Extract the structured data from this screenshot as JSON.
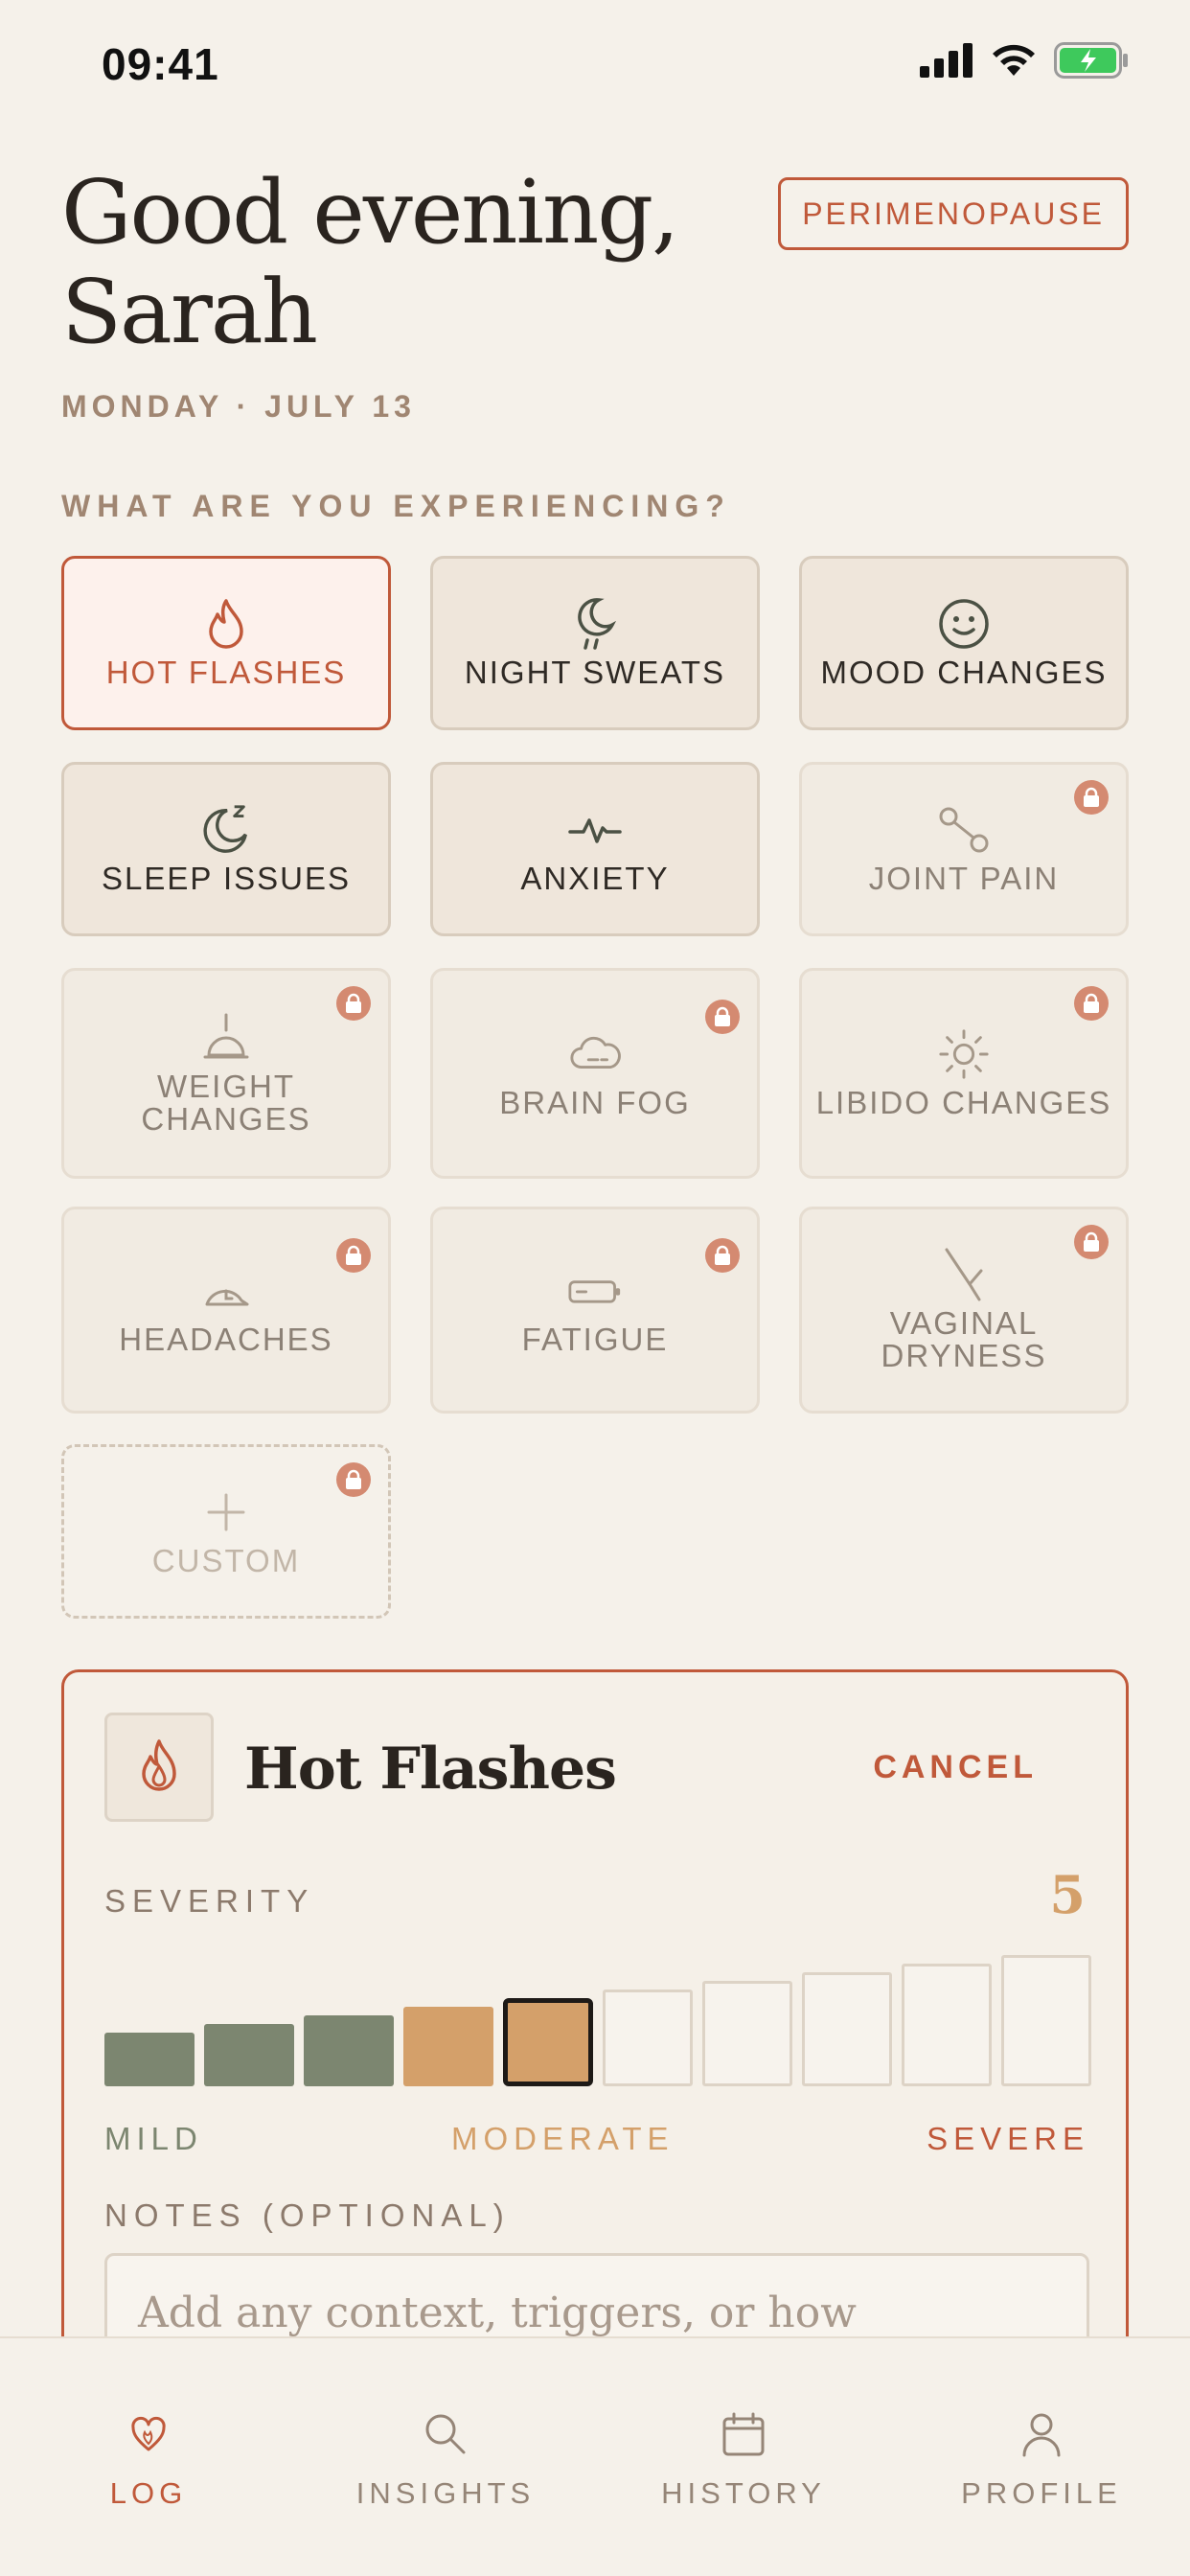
{
  "status_bar": {
    "time": "09:41"
  },
  "header": {
    "greeting": "Good evening, Sarah",
    "phase_badge": "PERIMENOPAUSE",
    "date": "MONDAY · JULY 13"
  },
  "symptoms_section": {
    "label": "WHAT ARE YOU EXPERIENCING?"
  },
  "symptoms": [
    {
      "label": "HOT FLASHES",
      "icon": "flame-icon",
      "state": "selected",
      "locked": false
    },
    {
      "label": "NIGHT SWEATS",
      "icon": "moon-drops-icon",
      "state": "available",
      "locked": false
    },
    {
      "label": "MOOD CHANGES",
      "icon": "smiley-icon",
      "state": "available",
      "locked": false
    },
    {
      "label": "SLEEP ISSUES",
      "icon": "moon-z-icon",
      "state": "available",
      "locked": false
    },
    {
      "label": "ANXIETY",
      "icon": "pulse-icon",
      "state": "available",
      "locked": false
    },
    {
      "label": "JOINT PAIN",
      "icon": "joint-icon",
      "state": "locked",
      "locked": true
    },
    {
      "label": "WEIGHT CHANGES",
      "icon": "scale-icon",
      "state": "locked",
      "locked": true
    },
    {
      "label": "BRAIN FOG",
      "icon": "cloud-icon",
      "state": "locked",
      "locked": true
    },
    {
      "label": "LIBIDO CHANGES",
      "icon": "sun-icon",
      "state": "locked",
      "locked": true
    },
    {
      "label": "HEADACHES",
      "icon": "head-icon",
      "state": "locked",
      "locked": true
    },
    {
      "label": "FATIGUE",
      "icon": "battery-icon",
      "state": "locked",
      "locked": true
    },
    {
      "label": "VAGINAL DRYNESS",
      "icon": "feather-icon",
      "state": "locked",
      "locked": true
    },
    {
      "label": "CUSTOM",
      "icon": "plus-icon",
      "state": "custom",
      "locked": true
    }
  ],
  "detail_panel": {
    "title": "Hot Flashes",
    "cancel_label": "CANCEL",
    "severity_label": "SEVERITY",
    "severity_value": "5",
    "severity_level": 5,
    "severity_max": 10,
    "scale_labels": {
      "mild": "MILD",
      "moderate": "MODERATE",
      "severe": "SEVERE"
    },
    "notes_label": "NOTES (OPTIONAL)",
    "notes_placeholder": "Add any context, triggers, or how"
  },
  "tabbar": [
    {
      "label": "LOG",
      "icon": "heart-icon",
      "active": true
    },
    {
      "label": "INSIGHTS",
      "icon": "search-icon",
      "active": false
    },
    {
      "label": "HISTORY",
      "icon": "calendar-icon",
      "active": false
    },
    {
      "label": "PROFILE",
      "icon": "person-icon",
      "active": false
    }
  ],
  "colors": {
    "accent": "#c0593a",
    "mild": "#7c8670",
    "moderate": "#d4a06a",
    "background": "#f5f1ea"
  }
}
